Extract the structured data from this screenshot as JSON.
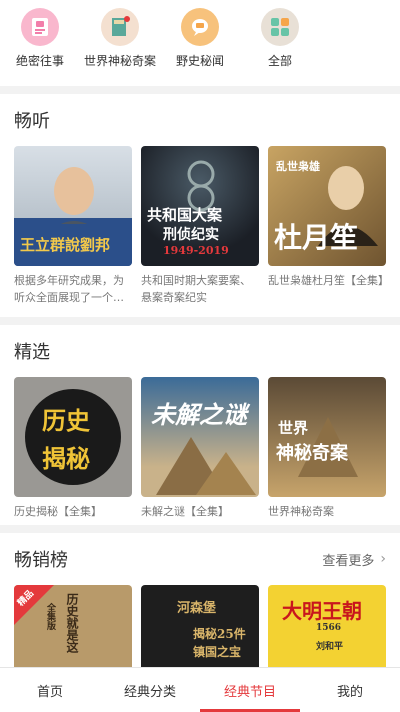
{
  "top_categories": [
    {
      "label": "绝密往事",
      "icon": "secret-file-icon",
      "color": "#f27eaa"
    },
    {
      "label": "世界神秘奇案",
      "icon": "case-book-icon",
      "color": "#f5d3b8"
    },
    {
      "label": "野史秘闻",
      "icon": "chat-bubble-icon",
      "color": "#f5a54a"
    },
    {
      "label": "全部",
      "icon": "grid-icon",
      "color": "#67c4a7"
    }
  ],
  "sections": {
    "changting": {
      "title": "畅听",
      "items": [
        {
          "title": "根据多年研究成果，为听众全面展现了一个…",
          "cover_text": "王立群說劉邦"
        },
        {
          "title": "共和国时期大案要案、悬案奇案纪实",
          "cover_text_1": "共和国大案",
          "cover_text_2": "刑侦纪实",
          "cover_text_3": "1949-2019"
        },
        {
          "title": "乱世枭雄杜月笙【全集】",
          "cover_text_1": "乱世枭雄",
          "cover_text_2": "杜月笙"
        }
      ]
    },
    "jingxuan": {
      "title": "精选",
      "items": [
        {
          "title": "历史揭秘【全集】",
          "cover_text_1": "历史",
          "cover_text_2": "揭秘"
        },
        {
          "title": "未解之谜【全集】",
          "cover_text": "未解之谜"
        },
        {
          "title": "世界神秘奇案",
          "cover_text_1": "世界",
          "cover_text_2": "神秘奇案"
        }
      ]
    },
    "changxiao": {
      "title": "畅销榜",
      "more_label": "查看更多",
      "items": [
        {
          "badge": "精品",
          "cover_text": "历史就是这",
          "cover_side": "全集版"
        },
        {
          "cover_text_1": "河森堡",
          "cover_text_2": "揭秘25件",
          "cover_text_3": "镇国之宝"
        },
        {
          "cover_text_1": "大明王朝",
          "cover_text_2": "1566",
          "cover_text_3": "刘和平"
        }
      ]
    }
  },
  "bottom_nav": [
    {
      "label": "首页",
      "active": false
    },
    {
      "label": "经典分类",
      "active": false
    },
    {
      "label": "经典节目",
      "active": true
    },
    {
      "label": "我的",
      "active": false
    }
  ],
  "colors": {
    "accent": "#e4393c"
  }
}
